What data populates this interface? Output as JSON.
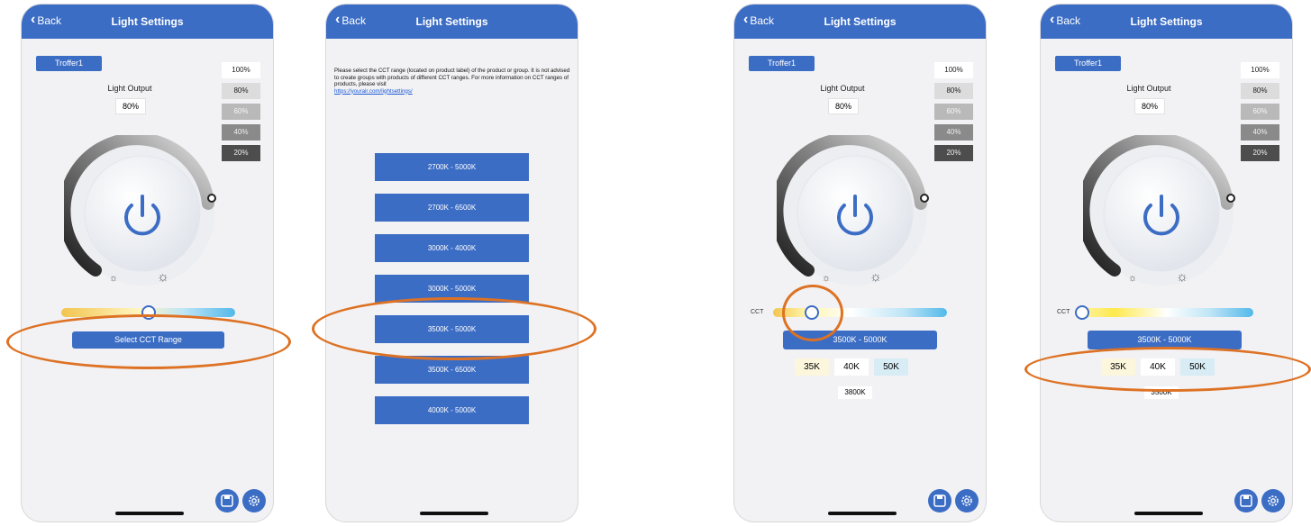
{
  "nav": {
    "back_label": "Back",
    "title": "Light Settings"
  },
  "device_name": "Troffer1",
  "light_output": {
    "label": "Light Output",
    "value": "80%"
  },
  "presets": [
    {
      "label": "100%",
      "bg": "#ffffff",
      "fg": "#222222"
    },
    {
      "label": "80%",
      "bg": "#dcdcdc",
      "fg": "#222222"
    },
    {
      "label": "60%",
      "bg": "#b9b9b9",
      "fg": "#f5f5f5"
    },
    {
      "label": "40%",
      "bg": "#8a8a8a",
      "fg": "#eeeeee"
    },
    {
      "label": "20%",
      "bg": "#4d4d4d",
      "fg": "#eeeeee"
    }
  ],
  "screen1": {
    "select_cct_button": "Select CCT Range"
  },
  "screen2": {
    "instructions": "Please select the CCT range (located on product label) of the product or group. It is not advised to create groups with products of different CCT ranges. For more information on CCT ranges of products, please visit",
    "link": "https://yourair.com/lightsettings/",
    "ranges": [
      "2700K - 5000K",
      "2700K - 6500K",
      "3000K - 4000K",
      "3000K - 5000K",
      "3500K - 5000K",
      "3500K - 6500K",
      "4000K - 5000K"
    ]
  },
  "screen3": {
    "cct_label": "CCT",
    "range_button": "3500K - 5000K",
    "chips": [
      {
        "label": "35K",
        "bg": "#fbf6dc"
      },
      {
        "label": "40K",
        "bg": "#ffffff"
      },
      {
        "label": "50K",
        "bg": "#d7ecf4"
      }
    ],
    "current_cct": "3800K"
  },
  "screen4": {
    "cct_label": "CCT",
    "range_button": "3500K - 5000K",
    "chips": [
      {
        "label": "35K",
        "bg": "#fbf6dc"
      },
      {
        "label": "40K",
        "bg": "#ffffff"
      },
      {
        "label": "50K",
        "bg": "#d7ecf4"
      }
    ],
    "current_cct": "3500K"
  },
  "colors": {
    "accent": "#3c6dc5",
    "annotation": "#dd7224"
  }
}
